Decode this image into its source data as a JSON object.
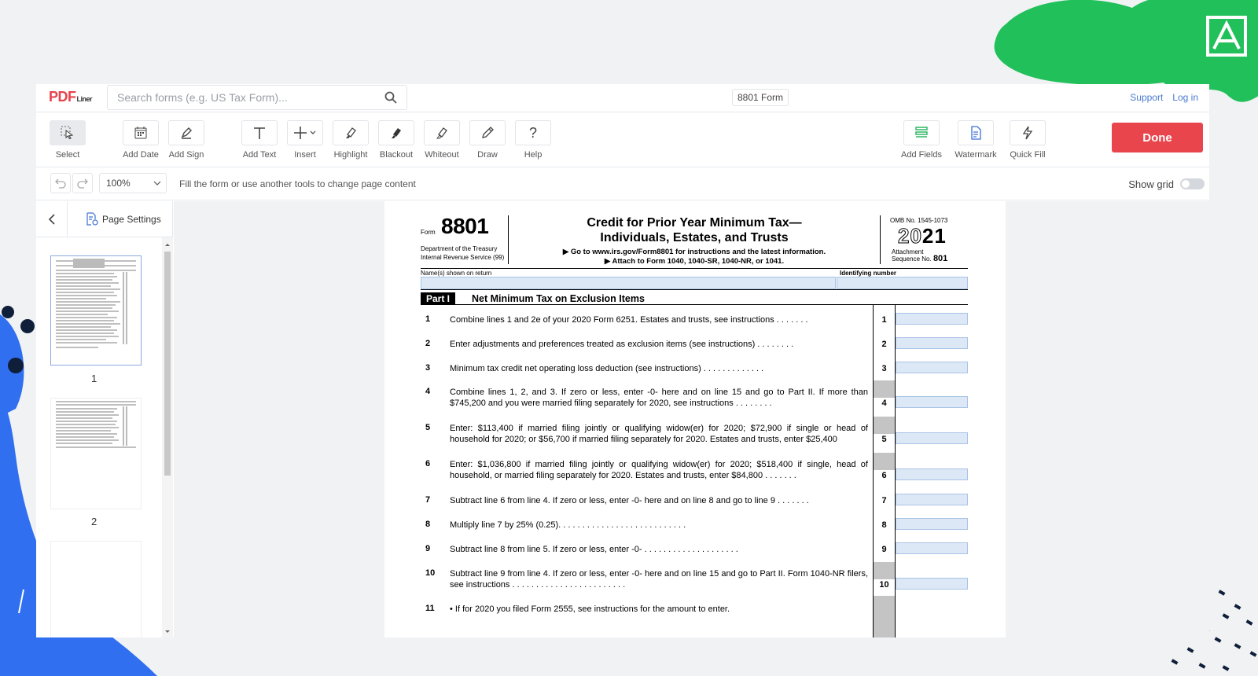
{
  "header": {
    "logo_main": "PDF",
    "logo_sub": "Liner",
    "search_placeholder": "Search forms (e.g. US Tax Form)...",
    "doc_title": "8801 Form",
    "support": "Support",
    "login": "Log in"
  },
  "toolbar": {
    "tools": [
      {
        "label": "Select",
        "icon": "cursor-icon"
      },
      {
        "label": "Add Date",
        "icon": "calendar-icon"
      },
      {
        "label": "Add Sign",
        "icon": "signature-icon"
      },
      {
        "label": "Add Text",
        "icon": "text-icon"
      },
      {
        "label": "Insert",
        "icon": "plus-icon"
      },
      {
        "label": "Highlight",
        "icon": "highlighter-icon"
      },
      {
        "label": "Blackout",
        "icon": "blackout-icon"
      },
      {
        "label": "Whiteout",
        "icon": "whiteout-icon"
      },
      {
        "label": "Draw",
        "icon": "pen-icon"
      },
      {
        "label": "Help",
        "icon": "question-icon"
      }
    ],
    "right_tools": [
      {
        "label": "Add Fields",
        "icon": "fields-icon"
      },
      {
        "label": "Watermark",
        "icon": "watermark-icon"
      },
      {
        "label": "Quick Fill",
        "icon": "lightning-icon"
      }
    ],
    "done": "Done"
  },
  "subbar": {
    "zoom": "100%",
    "hint": "Fill the form or use another tools to change page content",
    "show_grid": "Show grid"
  },
  "sidebar": {
    "page_settings": "Page Settings",
    "pages": [
      "1",
      "2"
    ]
  },
  "form": {
    "form_label": "Form",
    "form_number": "8801",
    "dept": "Department of the Treasury",
    "irs": "Internal Revenue Service (99)",
    "title1": "Credit for Prior Year Minimum Tax—",
    "title2": "Individuals, Estates, and Trusts",
    "goto": "▶ Go to www.irs.gov/Form8801 for instructions and the latest information.",
    "attach": "▶ Attach to Form 1040, 1040-SR, 1040-NR, or 1041.",
    "omb": "OMB No. 1545-1073",
    "year_a": "20",
    "year_b": "21",
    "att1": "Attachment",
    "att2": "Sequence No.",
    "seq": "801",
    "name_label": "Name(s) shown on return",
    "id_label": "Identifying number",
    "part_label": "Part I",
    "part_title": "Net Minimum Tax on Exclusion Items",
    "lines": [
      {
        "num": "1",
        "text": "Combine lines 1 and 2e of your 2020 Form 6251. Estates and trusts, see instructions . . . . . . .",
        "box": "1"
      },
      {
        "num": "2",
        "text": "Enter adjustments and preferences treated as exclusion items (see instructions) . . . . . . . .",
        "box": "2"
      },
      {
        "num": "3",
        "text": "Minimum tax credit net operating loss deduction (see instructions) . . . . . . . . . . . . .",
        "box": "3"
      },
      {
        "num": "4",
        "text": "Combine lines 1, 2, and 3. If zero or less, enter -0- here and on line 15 and go to Part II. If more than $745,200 and you were married filing separately for 2020, see instructions . . . . . . . .",
        "box": "4"
      },
      {
        "num": "5",
        "text": "Enter: $113,400 if married filing jointly or qualifying widow(er) for 2020; $72,900 if single or head of household for 2020; or $56,700 if married filing separately for 2020. Estates and trusts, enter $25,400",
        "box": "5"
      },
      {
        "num": "6",
        "text": "Enter: $1,036,800 if married filing jointly or qualifying widow(er) for 2020; $518,400 if single, head of household, or married filing separately for 2020. Estates and trusts, enter $84,800 . . . . . . .",
        "box": "6"
      },
      {
        "num": "7",
        "text": "Subtract line 6 from line 4. If zero or less, enter -0- here and on line 8 and go to line 9 . . . . . . .",
        "box": "7"
      },
      {
        "num": "8",
        "text": "Multiply line 7 by 25% (0.25). . . . . . . . . . . . . . . . . . . . . . . . . . .",
        "box": "8"
      },
      {
        "num": "9",
        "text": "Subtract line 8 from line 5. If zero or less, enter -0- . . . . . . . . . . . . . . . . . . . .",
        "box": "9"
      },
      {
        "num": "10",
        "text": "Subtract line 9 from line 4. If zero or less, enter -0- here and on line 15 and go to Part II. Form 1040-NR filers, see instructions . . . . . . . . . . . . . . . . . . . . . . . .",
        "box": "10"
      },
      {
        "num": "11",
        "text": "• If for 2020 you filed Form 2555, see instructions for the amount to enter.",
        "box": ""
      }
    ]
  }
}
